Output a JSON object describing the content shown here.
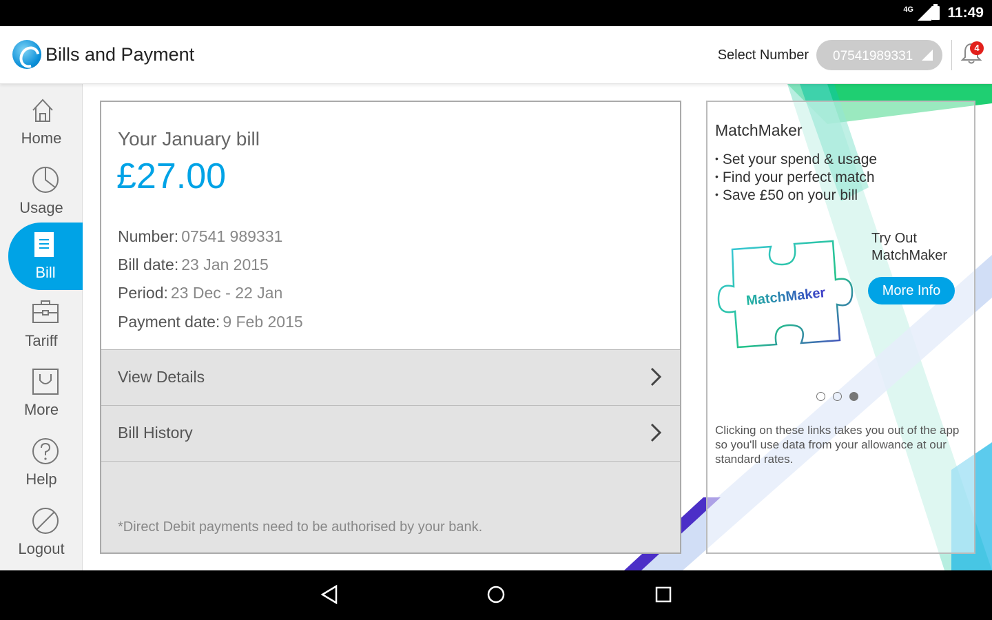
{
  "status_bar": {
    "network": "4G",
    "time": "11:49"
  },
  "header": {
    "title": "Bills and Payment",
    "select_label": "Select Number",
    "selected_number": "07541989331",
    "notification_count": "4"
  },
  "sidebar": {
    "items": [
      {
        "label": "Home",
        "icon": "home-icon"
      },
      {
        "label": "Usage",
        "icon": "pie-chart-icon"
      },
      {
        "label": "Bill",
        "icon": "document-icon"
      },
      {
        "label": "Tariff",
        "icon": "briefcase-icon"
      },
      {
        "label": "More",
        "icon": "bag-icon"
      },
      {
        "label": "Help",
        "icon": "question-icon"
      },
      {
        "label": "Logout",
        "icon": "no-entry-icon"
      }
    ],
    "active": "Bill"
  },
  "bill": {
    "heading": "Your January bill",
    "amount": "£27.00",
    "details": [
      {
        "label": "Number:",
        "value": "07541 989331"
      },
      {
        "label": "Bill date:",
        "value": "23 Jan 2015"
      },
      {
        "label": "Period:",
        "value": "23 Dec - 22 Jan"
      },
      {
        "label": "Payment date:",
        "value": "9 Feb 2015"
      }
    ],
    "links": [
      {
        "label": "View Details"
      },
      {
        "label": "Bill History"
      }
    ],
    "note": "*Direct Debit payments need to be authorised by your bank."
  },
  "promo": {
    "title": "MatchMaker",
    "bullets": [
      "Set your spend & usage",
      "Find your perfect match",
      "Save £50 on your bill"
    ],
    "puzzle_text": "MatchMaker",
    "try_out": "Try Out MatchMaker",
    "button": "More Info",
    "carousel": {
      "count": 3,
      "active_index": 2
    },
    "disclaimer": "Clicking on these links takes you out of the app so you'll use data from your allowance at our standard rates."
  },
  "colors": {
    "accent": "#00a3e6",
    "badge": "#e2201c"
  }
}
